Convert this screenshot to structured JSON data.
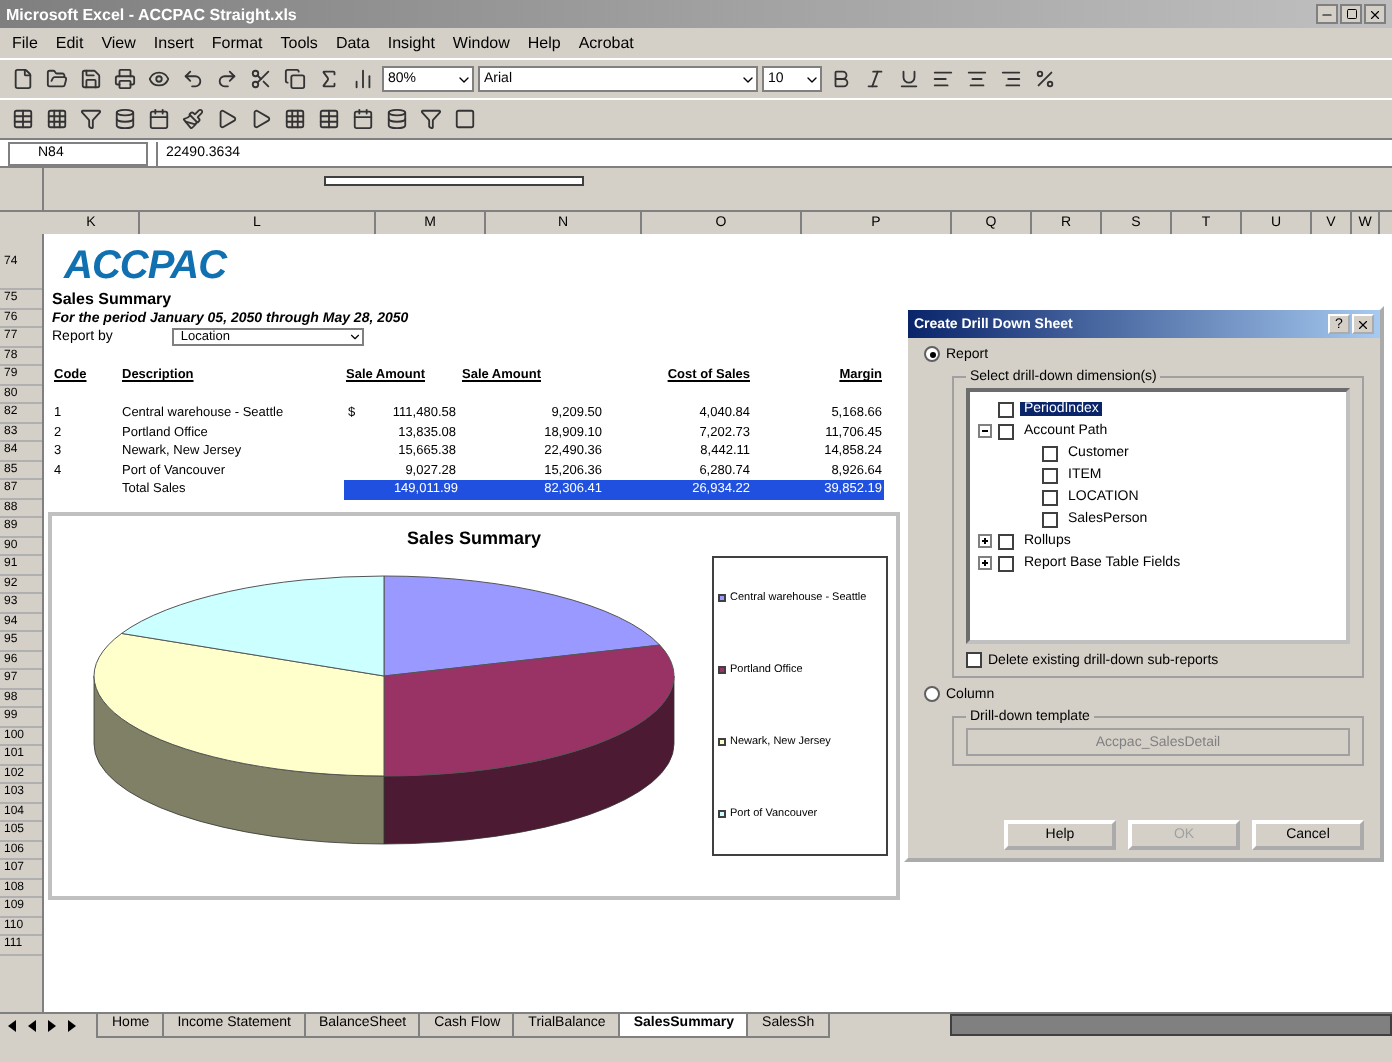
{
  "window": {
    "title": "Microsoft Excel - ACCPAC Straight.xls"
  },
  "menu": [
    "File",
    "Edit",
    "View",
    "Insert",
    "Format",
    "Tools",
    "Data",
    "Insight",
    "Window",
    "Help",
    "Acrobat"
  ],
  "toolbar": {
    "zoom": "80%",
    "font": "Arial",
    "font_size": "10"
  },
  "formula_bar": {
    "name_box": "N84",
    "value": "22490.3634"
  },
  "columns": [
    "K",
    "L",
    "M",
    "N",
    "O",
    "P",
    "Q",
    "R",
    "S",
    "T",
    "U",
    "V",
    "W"
  ],
  "rows": [
    "74",
    "75",
    "76",
    "77",
    "78",
    "79",
    "80",
    "82",
    "83",
    "84",
    "85",
    "87",
    "88",
    "89",
    "90",
    "91",
    "92",
    "93",
    "94",
    "95",
    "96",
    "97",
    "98",
    "99",
    "100",
    "101",
    "102",
    "103",
    "104",
    "105",
    "106",
    "107",
    "108",
    "109",
    "110",
    "111"
  ],
  "sheet": {
    "logo": "ACCPAC",
    "title": "Sales Summary",
    "period": "For the period January 05, 2050 through May 28, 2050",
    "report_by_label": "Report by",
    "report_by_value": "Location",
    "headers": [
      "Code",
      "Description",
      "Sale Amount",
      "Sale Amount",
      "Cost of Sales",
      "Margin"
    ],
    "lines": [
      {
        "code": "1",
        "description": "Central warehouse - Seattle",
        "currency": "$",
        "values": [
          "111,480.58",
          "9,209.50",
          "4,040.84",
          "5,168.66"
        ]
      },
      {
        "code": "2",
        "description": "Portland Office",
        "values": [
          "13,835.08",
          "18,909.10",
          "7,202.73",
          "11,706.45"
        ]
      },
      {
        "code": "3",
        "description": "Newark, New Jersey",
        "values": [
          "15,665.38",
          "22,490.36",
          "8,442.11",
          "14,858.24"
        ]
      },
      {
        "code": "4",
        "description": "Port of Vancouver",
        "values": [
          "9,027.28",
          "15,206.36",
          "6,280.74",
          "8,926.64"
        ]
      }
    ],
    "total": {
      "label": "Total Sales",
      "values": [
        "149,011.99",
        "82,306.41",
        "26,934.22",
        "39,852.19"
      ]
    }
  },
  "chart": {
    "title": "Sales Summary",
    "legend": [
      {
        "label": "Central warehouse - Seattle",
        "color": "#9999ff"
      },
      {
        "label": "Portland Office",
        "color": "#993366"
      },
      {
        "label": "Newark, New Jersey",
        "color": "#ffffcc"
      },
      {
        "label": "Port of Vancouver",
        "color": "#ccffff"
      }
    ]
  },
  "dialog": {
    "title": "Create Drill Down Sheet",
    "help_glyph": "?",
    "report_option": {
      "label": "Report",
      "selected": true
    },
    "group_label": "Select drill-down dimension(s)",
    "tree": [
      {
        "label": "PeriodIndex",
        "checked": false,
        "selected": true
      },
      {
        "label": "Account Path",
        "checked": false,
        "selected": false,
        "expanded": true,
        "children": [
          {
            "label": "Customer",
            "checked": false,
            "selected": false
          },
          {
            "label": "ITEM",
            "checked": false,
            "selected": false
          },
          {
            "label": "LOCATION",
            "checked": false,
            "selected": false
          },
          {
            "label": "SalesPerson",
            "checked": false,
            "selected": false
          }
        ]
      },
      {
        "label": "Rollups",
        "checked": false,
        "selected": false,
        "expanded": false
      },
      {
        "label": "Report Base Table Fields",
        "checked": false,
        "selected": false,
        "expanded": false
      }
    ],
    "delete_option": {
      "label": "Delete existing drill-down sub-reports",
      "checked": false
    },
    "column_option": {
      "label": "Column",
      "selected": false
    },
    "template_label": "Drill-down template",
    "template_value": "Accpac_SalesDetail",
    "buttons": [
      {
        "label": "Help",
        "disabled": false
      },
      {
        "label": "OK",
        "disabled": true
      },
      {
        "label": "Cancel",
        "disabled": false
      }
    ]
  },
  "tabs": [
    {
      "label": "Home",
      "selected": false
    },
    {
      "label": "Income Statement",
      "selected": false
    },
    {
      "label": "BalanceSheet",
      "selected": false
    },
    {
      "label": "Cash Flow",
      "selected": false
    },
    {
      "label": "TrialBalance",
      "selected": false
    },
    {
      "label": "SalesSummary",
      "selected": true
    },
    {
      "label": "SalesSh",
      "selected": false
    }
  ]
}
